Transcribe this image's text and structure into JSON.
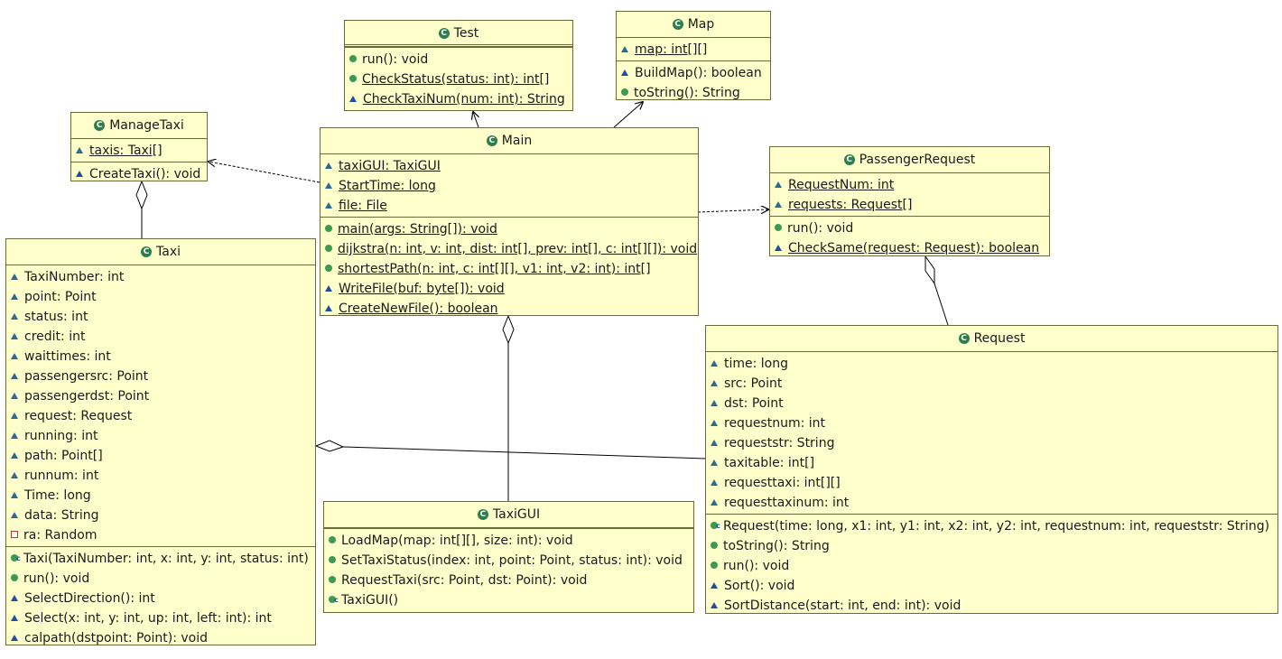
{
  "classes": [
    {
      "id": "test",
      "name": "Test",
      "double_header": true,
      "sections": [
        [],
        [
          {
            "vis": "public",
            "text": "run(): void"
          },
          {
            "vis": "public",
            "text": "CheckStatus(status: int): int[]",
            "static": true
          },
          {
            "vis": "package",
            "text": "CheckTaxiNum(num: int): String",
            "static": true
          }
        ]
      ]
    },
    {
      "id": "map",
      "name": "Map",
      "sections": [
        [
          {
            "vis": "package",
            "text": "map: int[][]",
            "static": true
          }
        ],
        [
          {
            "vis": "package",
            "text": "BuildMap(): boolean"
          },
          {
            "vis": "public",
            "text": "toString(): String"
          }
        ]
      ]
    },
    {
      "id": "managetaxi",
      "name": "ManageTaxi",
      "sections": [
        [
          {
            "vis": "package",
            "text": "taxis: Taxi[]",
            "static": true
          }
        ],
        [
          {
            "vis": "package",
            "text": "CreateTaxi(): void"
          }
        ]
      ]
    },
    {
      "id": "main",
      "name": "Main",
      "sections": [
        [
          {
            "vis": "package",
            "text": "taxiGUI: TaxiGUI",
            "static": true
          },
          {
            "vis": "package",
            "text": "StartTime: long",
            "static": true
          },
          {
            "vis": "package",
            "text": "file: File",
            "static": true
          }
        ],
        [
          {
            "vis": "public",
            "text": "main(args: String[]): void",
            "static": true
          },
          {
            "vis": "public",
            "text": "dijkstra(n: int, v: int, dist: int[], prev: int[], c: int[][]): void",
            "static": true
          },
          {
            "vis": "public",
            "text": "shortestPath(n: int, c: int[][], v1: int, v2: int): int[]",
            "static": true
          },
          {
            "vis": "package",
            "text": "WriteFile(buf: byte[]): void",
            "static": true
          },
          {
            "vis": "package",
            "text": "CreateNewFile(): boolean",
            "static": true
          }
        ]
      ]
    },
    {
      "id": "passengerrequest",
      "name": "PassengerRequest",
      "sections": [
        [
          {
            "vis": "package",
            "text": "RequestNum: int",
            "static": true
          },
          {
            "vis": "package",
            "text": "requests: Request[]",
            "static": true
          }
        ],
        [
          {
            "vis": "public",
            "text": "run(): void"
          },
          {
            "vis": "package",
            "text": "CheckSame(request: Request): boolean",
            "static": true
          }
        ]
      ]
    },
    {
      "id": "taxi",
      "name": "Taxi",
      "sections": [
        [
          {
            "vis": "package",
            "text": "TaxiNumber: int"
          },
          {
            "vis": "package",
            "text": "point: Point"
          },
          {
            "vis": "package",
            "text": "status: int"
          },
          {
            "vis": "package",
            "text": "credit: int"
          },
          {
            "vis": "package",
            "text": "waittimes: int"
          },
          {
            "vis": "package",
            "text": "passengersrc: Point"
          },
          {
            "vis": "package",
            "text": "passengerdst: Point"
          },
          {
            "vis": "package",
            "text": "request: Request"
          },
          {
            "vis": "package",
            "text": "running: int"
          },
          {
            "vis": "package",
            "text": "path: Point[]"
          },
          {
            "vis": "package",
            "text": "runnum: int"
          },
          {
            "vis": "package",
            "text": "Time: long"
          },
          {
            "vis": "package",
            "text": "data: String"
          },
          {
            "vis": "private",
            "text": "ra: Random"
          }
        ],
        [
          {
            "vis": "ctor",
            "text": "Taxi(TaxiNumber: int, x: int, y: int, status: int)"
          },
          {
            "vis": "public",
            "text": "run(): void"
          },
          {
            "vis": "package",
            "text": "SelectDirection(): int"
          },
          {
            "vis": "package",
            "text": "Select(x: int, y: int, up: int, left: int): int"
          },
          {
            "vis": "package",
            "text": "calpath(dstpoint: Point): void"
          }
        ]
      ]
    },
    {
      "id": "request",
      "name": "Request",
      "sections": [
        [
          {
            "vis": "package",
            "text": "time: long"
          },
          {
            "vis": "package",
            "text": "src: Point"
          },
          {
            "vis": "package",
            "text": "dst: Point"
          },
          {
            "vis": "package",
            "text": "requestnum: int"
          },
          {
            "vis": "package",
            "text": "requeststr: String"
          },
          {
            "vis": "package",
            "text": "taxitable: int[]"
          },
          {
            "vis": "package",
            "text": "requesttaxi: int[][]"
          },
          {
            "vis": "package",
            "text": "requesttaxinum: int"
          }
        ],
        [
          {
            "vis": "ctor",
            "text": "Request(time: long, x1: int, y1: int, x2: int, y2: int, requestnum: int, requeststr: String)"
          },
          {
            "vis": "public",
            "text": "toString(): String"
          },
          {
            "vis": "public",
            "text": "run(): void"
          },
          {
            "vis": "package",
            "text": "Sort(): void"
          },
          {
            "vis": "package",
            "text": "SortDistance(start: int, end: int): void"
          }
        ]
      ]
    },
    {
      "id": "taxigui",
      "name": "TaxiGUI",
      "sections": [
        [],
        [
          {
            "vis": "public",
            "text": "LoadMap(map: int[][], size: int): void"
          },
          {
            "vis": "public",
            "text": "SetTaxiStatus(index: int, point: Point, status: int): void"
          },
          {
            "vis": "public",
            "text": "RequestTaxi(src: Point, dst: Point): void"
          },
          {
            "vis": "ctor",
            "text": "TaxiGUI()"
          }
        ]
      ]
    }
  ],
  "edges": [
    {
      "from": "main",
      "to": "test",
      "type": "association"
    },
    {
      "from": "main",
      "to": "map",
      "type": "association"
    },
    {
      "from": "main",
      "to": "managetaxi",
      "type": "dependency"
    },
    {
      "from": "main",
      "to": "passengerrequest",
      "type": "dependency"
    },
    {
      "from": "managetaxi",
      "to": "taxi",
      "type": "aggregation"
    },
    {
      "from": "main",
      "to": "taxigui",
      "type": "aggregation"
    },
    {
      "from": "passengerrequest",
      "to": "request",
      "type": "aggregation"
    },
    {
      "from": "taxi",
      "to": "request",
      "type": "aggregation"
    }
  ]
}
